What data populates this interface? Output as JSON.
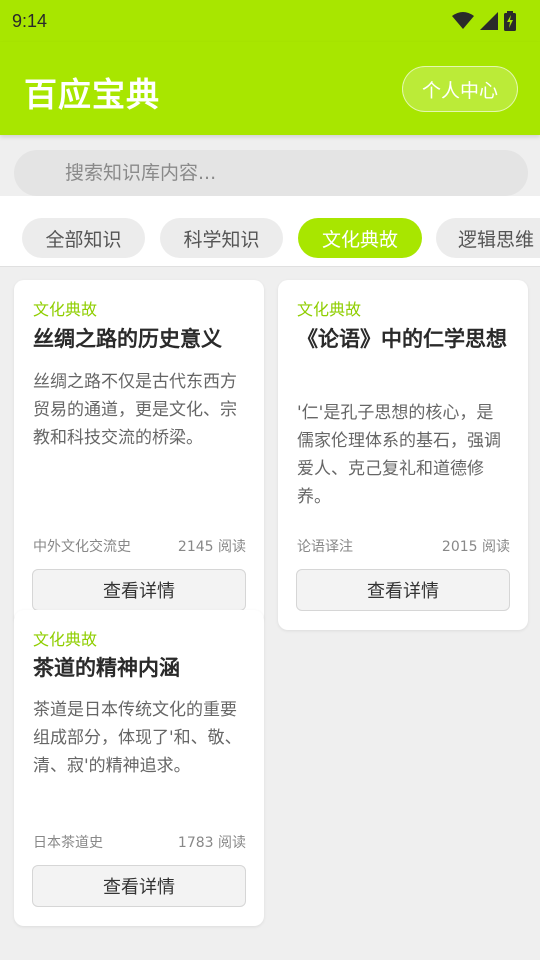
{
  "status_bar": {
    "time": "9:14"
  },
  "header": {
    "title": "百应宝典",
    "profile_button": "个人中心"
  },
  "search": {
    "placeholder": "搜索知识库内容..."
  },
  "tabs": [
    {
      "label": "全部知识",
      "active": false
    },
    {
      "label": "科学知识",
      "active": false
    },
    {
      "label": "文化典故",
      "active": true
    },
    {
      "label": "逻辑思维",
      "active": false
    }
  ],
  "cards": [
    {
      "category": "文化典故",
      "title": "丝绸之路的历史意义",
      "description": "丝绸之路不仅是古代东西方贸易的通道，更是文化、宗教和科技交流的桥梁。",
      "source": "中外文化交流史",
      "reads": "2145 阅读",
      "button": "查看详情"
    },
    {
      "category": "文化典故",
      "title": "《论语》中的仁学思想",
      "description": "'仁'是孔子思想的核心，是儒家伦理体系的基石，强调爱人、克己复礼和道德修养。",
      "source": "论语译注",
      "reads": "2015 阅读",
      "button": "查看详情"
    },
    {
      "category": "文化典故",
      "title": "茶道的精神内涵",
      "description": "茶道是日本传统文化的重要组成部分，体现了'和、敬、清、寂'的精神追求。",
      "source": "日本茶道史",
      "reads": "1783 阅读",
      "button": "查看详情"
    }
  ],
  "colors": {
    "accent": "#a8e600",
    "category_text": "#8fce00",
    "background": "#efefef"
  }
}
